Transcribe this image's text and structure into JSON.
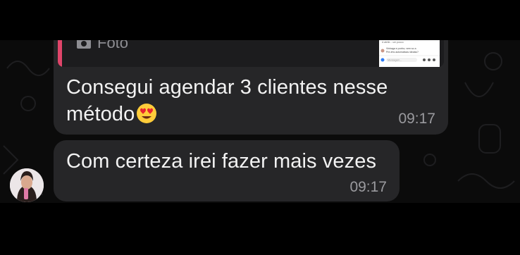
{
  "chat": {
    "messages": [
      {
        "quoted_media_label": "Foto",
        "quoted_thumb_lines": [
          "A atelie... um pouco",
          "Vinhaga e ponho, vem so a",
          "Pre-ehs automaticas ideaiss?",
          "Mensagem..."
        ],
        "text_before_emoji": "Consegui agendar 3 clientes nesse método",
        "emoji": "heart-eyes-emoji",
        "time": "09:17"
      },
      {
        "text": "Com certeza irei fazer mais vezes",
        "time": "09:17"
      }
    ]
  },
  "colors": {
    "background": "#000000",
    "bubble": "#262628",
    "quote_bar": "#e0456a",
    "timestamp": "#9a9a9e"
  }
}
